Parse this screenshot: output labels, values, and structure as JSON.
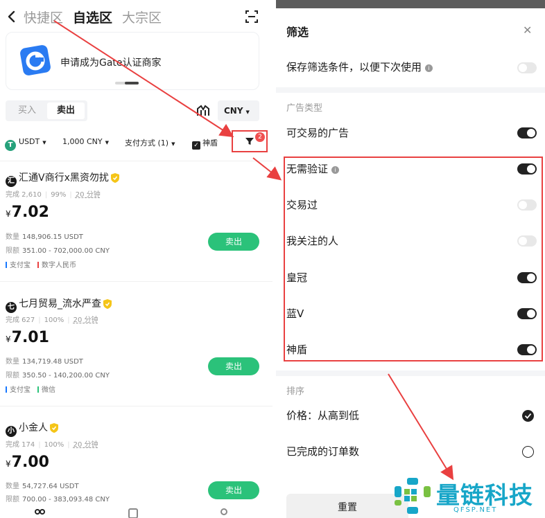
{
  "left": {
    "tabs": [
      "快捷区",
      "自选区",
      "大宗区"
    ],
    "active_tab": 1,
    "banner_text": "申请成为Gate认证商家",
    "buy_label": "买入",
    "sell_label": "卖出",
    "currency": "CNY",
    "filters": {
      "coin": "USDT",
      "amount": "1,000 CNY",
      "payment": "支付方式 (1)",
      "shield": "神盾",
      "badge": "2"
    },
    "ads": [
      {
        "avatar": "汇",
        "name": "汇通V商行x黑资勿扰",
        "stat_done": "完成 2,610",
        "stat_rate": "99%",
        "stat_time": "20 分钟",
        "currency_symbol": "¥",
        "price": "7.02",
        "qty_label": "数量",
        "qty": "148,906.15 USDT",
        "limit_label": "限额",
        "limit": "351.00 - 702,000.00 CNY",
        "pay1": "支付宝",
        "pay2": "数字人民币",
        "action": "卖出"
      },
      {
        "avatar": "七",
        "name": "七月贸易_流水严查",
        "stat_done": "完成 627",
        "stat_rate": "100%",
        "stat_time": "20 分钟",
        "currency_symbol": "¥",
        "price": "7.01",
        "qty_label": "数量",
        "qty": "134,719.48 USDT",
        "limit_label": "限额",
        "limit": "350.50 - 140,200.00 CNY",
        "pay1": "支付宝",
        "pay2": "微信",
        "action": "卖出"
      },
      {
        "avatar": "小",
        "name": "小金人",
        "stat_done": "完成 174",
        "stat_rate": "100%",
        "stat_time": "20 分钟",
        "currency_symbol": "¥",
        "price": "7.00",
        "qty_label": "数量",
        "qty": "54,727.64 USDT",
        "limit_label": "限额",
        "limit": "700.00 - 383,093.48 CNY",
        "action": "卖出"
      }
    ]
  },
  "right": {
    "title": "筛选",
    "save_label": "保存筛选条件，以便下次使用",
    "save_on": false,
    "ad_type_label": "广告类型",
    "tradeable_label": "可交易的广告",
    "tradeable_on": true,
    "options": [
      {
        "label": "无需验证",
        "on": true,
        "info": true
      },
      {
        "label": "交易过",
        "on": false
      },
      {
        "label": "我关注的人",
        "on": false
      },
      {
        "label": "皇冠",
        "on": true
      },
      {
        "label": "蓝V",
        "on": true
      },
      {
        "label": "神盾",
        "on": true
      }
    ],
    "sort_label": "排序",
    "sort_options": [
      {
        "label": "价格：从高到低",
        "selected": true
      },
      {
        "label": "已完成的订单数",
        "selected": false
      }
    ],
    "reset_label": "重置"
  },
  "watermark": {
    "title": "量链科技",
    "sub": "QFSP.NET"
  }
}
